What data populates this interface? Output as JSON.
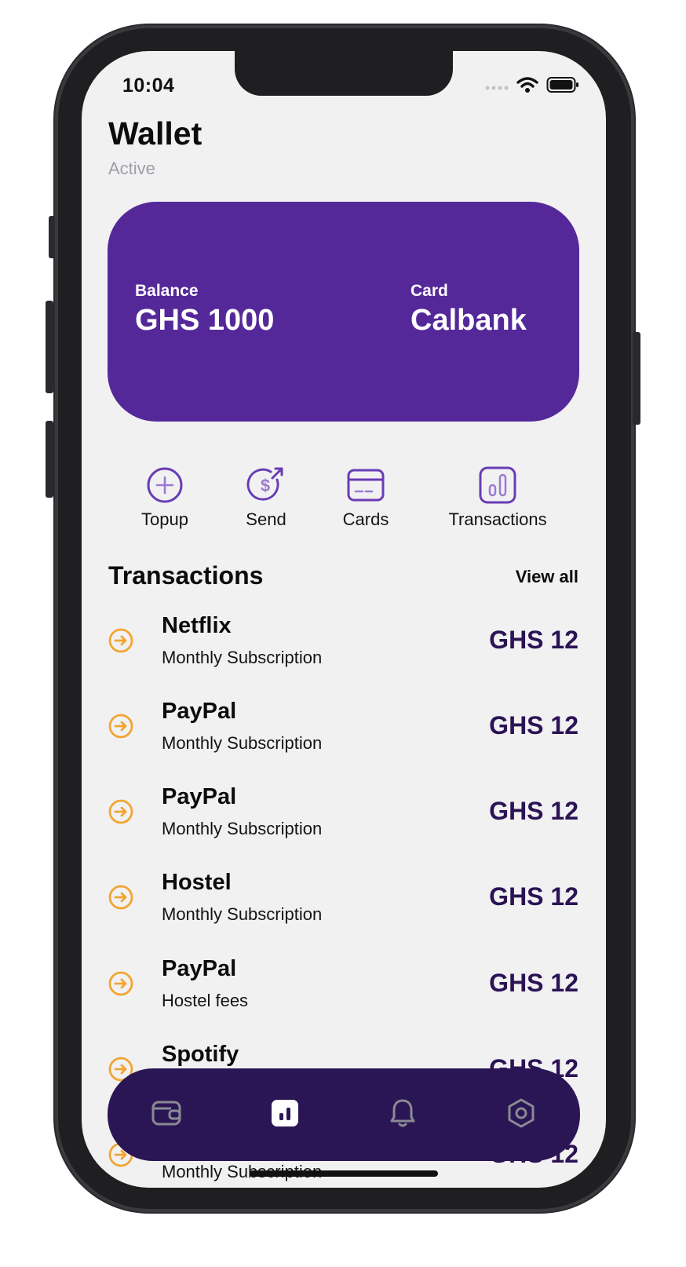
{
  "status_bar": {
    "time": "10:04"
  },
  "header": {
    "title": "Wallet",
    "subtitle": "Active"
  },
  "card": {
    "balance_label": "Balance",
    "balance_value": "GHS 1000",
    "card_label": "Card",
    "card_value": "Calbank",
    "color": "#55289a"
  },
  "actions": [
    {
      "label": "Topup",
      "icon": "plus-circle-icon"
    },
    {
      "label": "Send",
      "icon": "send-money-icon"
    },
    {
      "label": "Cards",
      "icon": "card-icon"
    },
    {
      "label": "Transactions",
      "icon": "bar-chart-icon"
    }
  ],
  "transactions_section": {
    "title": "Transactions",
    "view_all": "View all"
  },
  "transactions": [
    {
      "name": "Netflix",
      "description": "Monthly Subscription",
      "amount": "GHS 12"
    },
    {
      "name": "PayPal",
      "description": "Monthly Subscription",
      "amount": "GHS 12"
    },
    {
      "name": "PayPal",
      "description": "Monthly Subscription",
      "amount": "GHS 12"
    },
    {
      "name": "Hostel",
      "description": "Monthly Subscription",
      "amount": "GHS 12"
    },
    {
      "name": "PayPal",
      "description": "Hostel fees",
      "amount": "GHS 12"
    },
    {
      "name": "Spotify",
      "description": "",
      "amount": "GHS 12"
    },
    {
      "name": "",
      "description": "Monthly Subscription",
      "amount": "GHS 12"
    }
  ],
  "bottom_nav": [
    {
      "icon": "wallet-icon",
      "active": false
    },
    {
      "icon": "stats-icon",
      "active": true
    },
    {
      "icon": "bell-icon",
      "active": false
    },
    {
      "icon": "settings-hexagon-icon",
      "active": false
    }
  ],
  "colors": {
    "accent": "#55289a",
    "nav": "#2b1655",
    "amount": "#2b1355",
    "arrow": "#f2a531",
    "background": "#f1f1f2"
  }
}
